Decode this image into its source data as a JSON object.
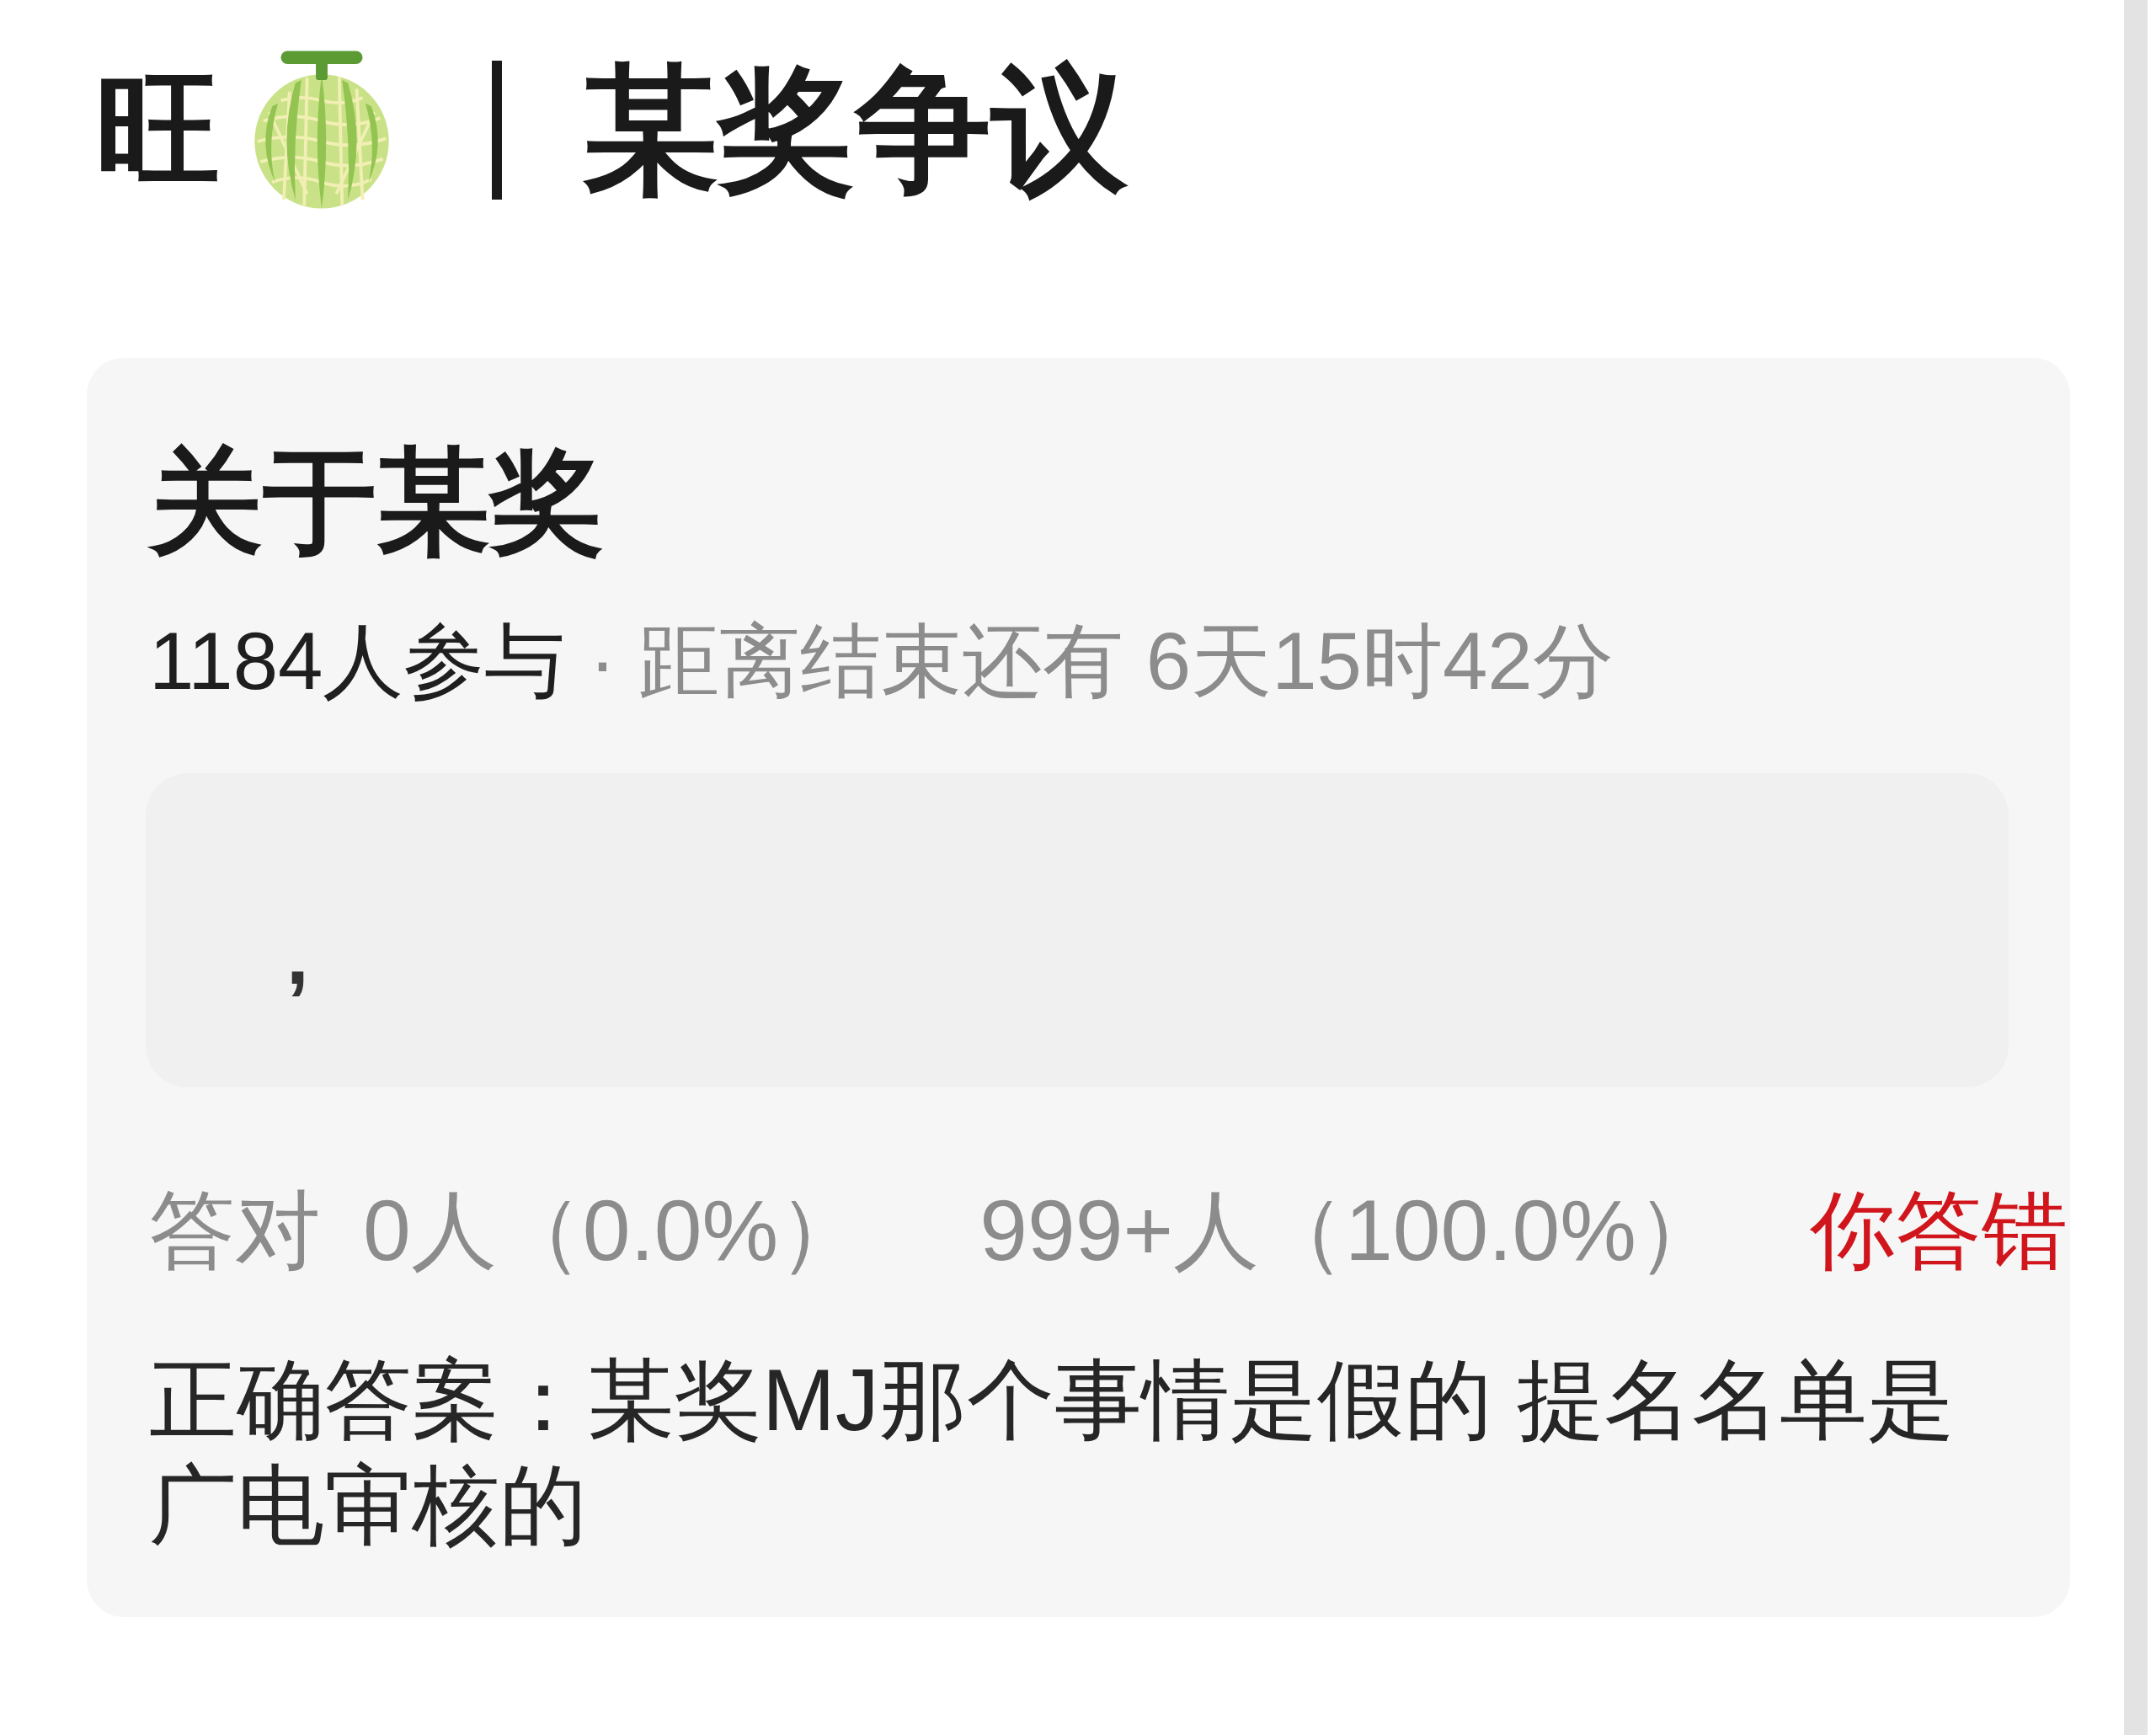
{
  "header": {
    "brand": "旺",
    "title": "某奖争议"
  },
  "poll": {
    "title": "关于某奖",
    "participants": "1184人参与",
    "countdown": "· 距离结束还有 6天15时42分",
    "option": {
      "text": ","
    },
    "stats": {
      "correct_label": "答对",
      "correct_count": "0人（0.0%）",
      "wrong_count": "999+人（100.0%）"
    },
    "result": {
      "text": "你答错",
      "correct": false
    },
    "answer": "正确答案：某奖MJ那个事情是假的 提名名单是广电审核的"
  }
}
